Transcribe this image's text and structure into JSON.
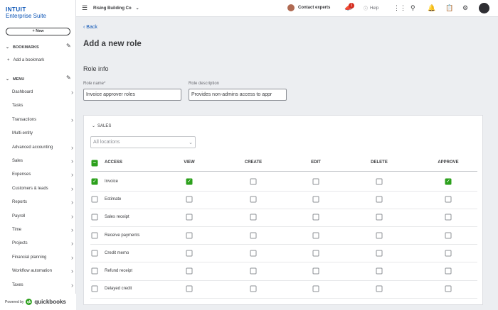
{
  "brand": {
    "intuit": "INTUIT",
    "suite": "Enterprise Suite"
  },
  "new_button": "New",
  "bookmarks": {
    "heading": "BOOKMARKS",
    "add": "Add a bookmark"
  },
  "menu": {
    "heading": "MENU",
    "items": [
      {
        "label": "Dashboard",
        "arrow": true
      },
      {
        "label": "Tasks",
        "arrow": false
      },
      {
        "label": "Transactions",
        "arrow": true
      },
      {
        "label": "Multi-entity",
        "arrow": false
      },
      {
        "label": "Advanced accounting",
        "arrow": true
      },
      {
        "label": "Sales",
        "arrow": true
      },
      {
        "label": "Expenses",
        "arrow": true
      },
      {
        "label": "Customers & leads",
        "arrow": true
      },
      {
        "label": "Reports",
        "arrow": true
      },
      {
        "label": "Payroll",
        "arrow": true
      },
      {
        "label": "Time",
        "arrow": true
      },
      {
        "label": "Projects",
        "arrow": true
      },
      {
        "label": "Financial planning",
        "arrow": true
      },
      {
        "label": "Workflow automation",
        "arrow": true
      },
      {
        "label": "Taxes",
        "arrow": true
      }
    ]
  },
  "powered": {
    "by": "Powered by",
    "brand": "quickbooks"
  },
  "topbar": {
    "company": "Rising Building Co",
    "contact": "Contact experts",
    "notif_count": "1",
    "help": "Help"
  },
  "page": {
    "back": "Back",
    "title": "Add a new role",
    "section": "Role info",
    "role_name_label": "Role name*",
    "role_name_value": "Invoice approver roles",
    "role_desc_label": "Role description",
    "role_desc_value": "Provides non-admins access to appr"
  },
  "permissions": {
    "group": "SALES",
    "location_placeholder": "All locations",
    "columns": [
      "ACCESS",
      "VIEW",
      "CREATE",
      "EDIT",
      "DELETE",
      "APPROVE"
    ],
    "rows": [
      {
        "label": "Invoice",
        "access": true,
        "view": true,
        "create": false,
        "edit": false,
        "delete": false,
        "approve": true
      },
      {
        "label": "Estimate",
        "access": false,
        "view": false,
        "create": false,
        "edit": false,
        "delete": false,
        "approve": false
      },
      {
        "label": "Sales receipt",
        "access": false,
        "view": false,
        "create": false,
        "edit": false,
        "delete": false,
        "approve": false
      },
      {
        "label": "Receive payments",
        "access": false,
        "view": false,
        "create": false,
        "edit": false,
        "delete": false,
        "approve": false
      },
      {
        "label": "Credit memo",
        "access": false,
        "view": false,
        "create": false,
        "edit": false,
        "delete": false,
        "approve": false
      },
      {
        "label": "Refund receipt",
        "access": false,
        "view": false,
        "create": false,
        "edit": false,
        "delete": false,
        "approve": false
      },
      {
        "label": "Delayed credit",
        "access": false,
        "view": false,
        "create": false,
        "edit": false,
        "delete": false,
        "approve": false
      }
    ]
  },
  "colors": {
    "accent": "#2ca01c",
    "link": "#0a53b5",
    "badge": "#d52b1e"
  }
}
